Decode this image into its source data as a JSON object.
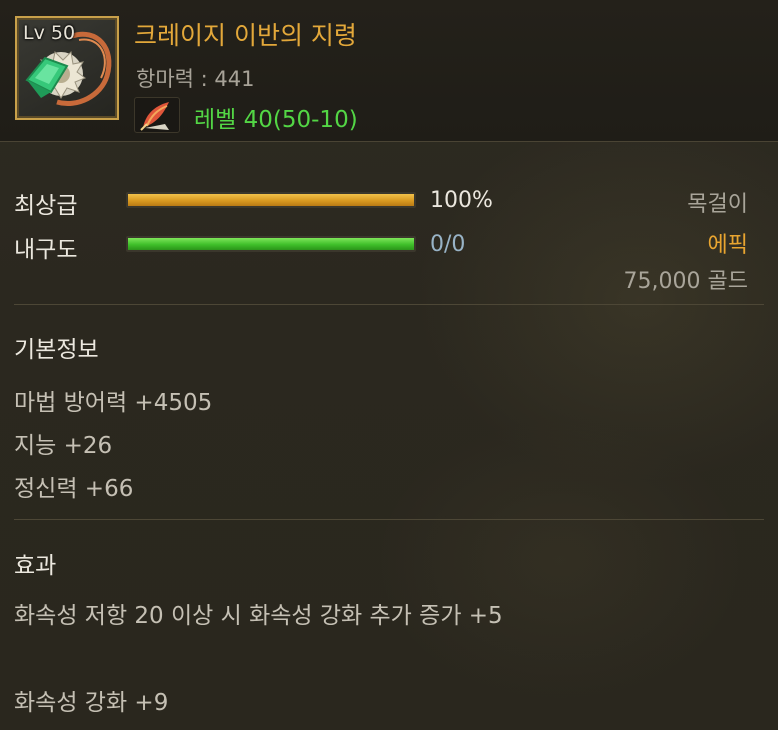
{
  "item": {
    "level_badge": "Lv 50",
    "name": "크레이지 이반의 지령",
    "stat_line": "항마력 : 441",
    "level_requirement": "레벨 40(50-10)",
    "icon": "gem-necklace-icon",
    "rune_icon": "quill-feather-icon"
  },
  "bars": [
    {
      "label": "최상급",
      "value_text": "100%",
      "fill_fraction": 1.0,
      "color": "#e0a22a"
    },
    {
      "label": "내구도",
      "value_text": "0/0",
      "fill_fraction": 1.0,
      "color": "#48c634"
    }
  ],
  "right_info": {
    "type": "목걸이",
    "rarity": "에픽",
    "price": "75,000 골드"
  },
  "basic_info": {
    "title": "기본정보",
    "lines": [
      "마법 방어력 +4505",
      "지능 +26",
      "정신력 +66"
    ]
  },
  "effects": {
    "title": "효과",
    "lines": [
      "화속성 저항 20 이상 시 화속성 강화 추가 증가 +5",
      "화속성 강화 +9"
    ]
  },
  "colors": {
    "item_name": "#e3a83a",
    "level_requirement": "#53d645",
    "rarity": "#e9a530",
    "icon_border": "#c8a04a"
  }
}
